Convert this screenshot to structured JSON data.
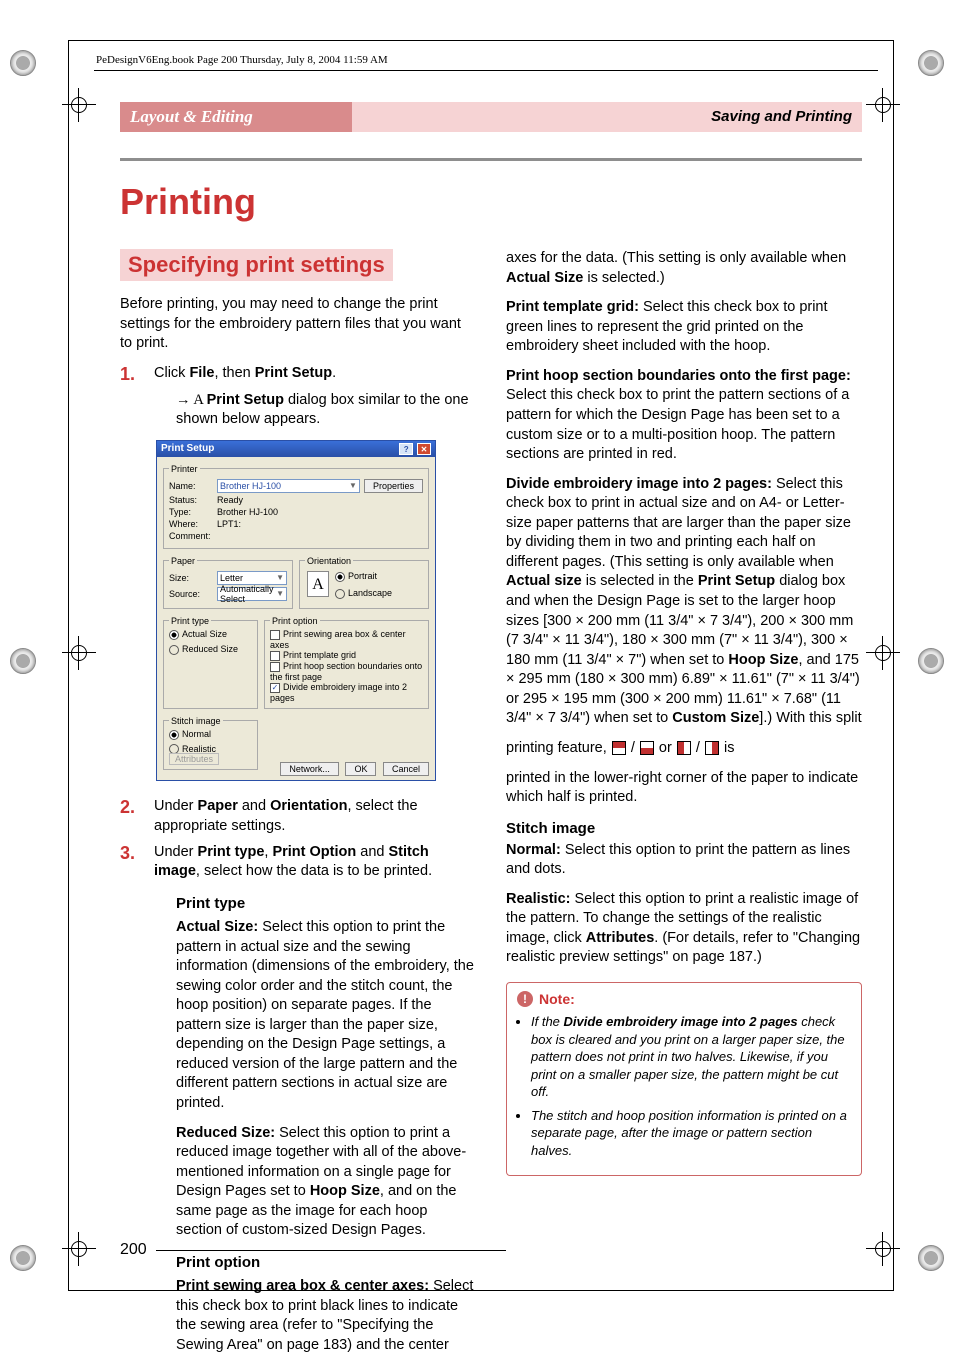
{
  "bookHeader": "PeDesignV6Eng.book  Page 200  Thursday, July 8, 2004  11:59 AM",
  "tabs": {
    "left": "Layout & Editing",
    "right": "Saving and Printing"
  },
  "title": "Printing",
  "subtitle": "Specifying print settings",
  "intro": "Before printing, you may need to change the print settings for the embroidery pattern files that you want to print.",
  "step1": {
    "num": "1.",
    "text_a": "Click ",
    "text_b": "File",
    "text_c": ", then ",
    "text_d": "Print Setup",
    "text_e": ".",
    "result_pre": "→ A ",
    "result_b": "Print Setup",
    "result_post": " dialog box similar to the one shown below appears."
  },
  "dialog": {
    "title": "Print Setup",
    "printer": {
      "legend": "Printer",
      "name_lbl": "Name:",
      "name_val": "Brother HJ-100",
      "properties": "Properties",
      "status_lbl": "Status:",
      "status_val": "Ready",
      "type_lbl": "Type:",
      "type_val": "Brother HJ-100",
      "where_lbl": "Where:",
      "where_val": "LPT1:",
      "comment_lbl": "Comment:"
    },
    "paper": {
      "legend": "Paper",
      "size_lbl": "Size:",
      "size_val": "Letter",
      "source_lbl": "Source:",
      "source_val": "Automatically Select"
    },
    "orientation": {
      "legend": "Orientation",
      "portrait": "Portrait",
      "landscape": "Landscape"
    },
    "printtype": {
      "legend": "Print type",
      "actual": "Actual Size",
      "reduced": "Reduced Size"
    },
    "printoption": {
      "legend": "Print option",
      "o1": "Print sewing area box & center axes",
      "o2": "Print template grid",
      "o3": "Print hoop section boundaries onto the first page",
      "o4": "Divide embroidery image into 2 pages"
    },
    "stitch": {
      "legend": "Stitch image",
      "normal": "Normal",
      "realistic": "Realistic",
      "attributes": "Attributes"
    },
    "btns": {
      "network": "Network...",
      "ok": "OK",
      "cancel": "Cancel"
    }
  },
  "step2": {
    "num": "2.",
    "a": "Under ",
    "b": "Paper",
    "c": " and ",
    "d": "Orientation",
    "e": ", select the appropriate settings."
  },
  "step3": {
    "num": "3.",
    "a": "Under ",
    "b": "Print type",
    "c": ", ",
    "d": "Print Option",
    "e": " and ",
    "f": "Stitch image",
    "g": ", select how the data is to be printed."
  },
  "sections": {
    "print_type_hd": "Print type",
    "actual_b": "Actual Size:",
    "actual_txt": " Select this option to print the pattern in actual size and the sewing information (dimensions of the embroidery, the sewing color order and the stitch count, the hoop position) on separate pages. If the pattern size is larger than the paper size, depending on the Design Page settings, a reduced version of the large pattern and the different pattern sections in actual size are printed.",
    "reduced_b": "Reduced Size:",
    "reduced_txt": " Select this option to print a reduced image together with all of the above-mentioned information on a single page for Design Pages set to ",
    "reduced_hoop": "Hoop Size",
    "reduced_txt2": ", and on the same page as the image for each hoop section of custom-sized Design Pages.",
    "print_option_hd": "Print option",
    "axes_b": "Print sewing area box & center axes:",
    "axes_txt": " Select this check box to print black lines to indicate the sewing area (refer to \"Specifying the Sewing Area\" on page 183) and the center"
  },
  "col2": {
    "axes_cont": "axes for the data. (This setting is only available when ",
    "axes_cont_b": "Actual Size",
    "axes_cont2": " is selected.)",
    "grid_b": "Print template grid:",
    "grid_txt": " Select this check box to print green lines to represent the grid printed on the embroidery sheet included with the hoop.",
    "bound_b": "Print hoop section boundaries onto the first page:",
    "bound_txt": " Select this check box to print the pattern sections of a pattern for which the Design Page has been set to a custom size or to a multi-position hoop. The pattern sections are printed in red.",
    "divide_b": "Divide embroidery image into 2 pages:",
    "divide_txt1": " Select this check box to print in actual size and on A4- or Letter-size paper patterns that are larger than the paper size by dividing them in two and printing each half on different pages. (This setting is only available when ",
    "divide_as": "Actual size",
    "divide_txt2": " is selected in the ",
    "divide_ps": "Print Setup",
    "divide_txt3": " dialog box and when the Design Page is set to the larger hoop sizes [300 × 200 mm (11 3/4\" × 7 3/4\"), 200 × 300 mm (7 3/4\" × 11 3/4\"), 180 × 300 mm (7\" × 11 3/4\"), 300 × 180 mm (11 3/4\" × 7\") when set to ",
    "divide_hoop": "Hoop Size",
    "divide_txt4": ", and 175 × 295 mm (180 × 300 mm) 6.89\" × 11.61\" (7\" × 11 3/4\") or 295 × 195 mm (300 × 200 mm) 11.61\" × 7.68\" (11 3/4\" × 7 3/4\") when set to ",
    "divide_custom": "Custom Size",
    "divide_txt5": "].) With this split",
    "printing_feature": "printing feature, ",
    "or": " or ",
    "slash": " / ",
    "is": " is",
    "printed_lower": "printed in the lower-right corner of the paper to indicate which half is printed.",
    "stitch_hd": "Stitch image",
    "normal_b": "Normal:",
    "normal_txt": " Select this option to print the pattern as lines and dots.",
    "realistic_b": "Realistic:",
    "realistic_txt": " Select this option to print a realistic image of the pattern. To change the settings of the realistic image, click ",
    "realistic_attr": "Attributes",
    "realistic_txt2": ". (For details, refer to \"Changing realistic preview settings\" on page 187.)"
  },
  "note": {
    "hd": "Note:",
    "li1a": "If the ",
    "li1b": "Divide embroidery image into 2 pages",
    "li1c": " check box is cleared and you print on a larger paper size, the pattern does not print in two halves. Likewise, if you print on a smaller paper size, the pattern might be cut off.",
    "li2": "The stitch and hoop position information is printed on a separate page, after the image or pattern section halves."
  },
  "pageNumber": "200"
}
